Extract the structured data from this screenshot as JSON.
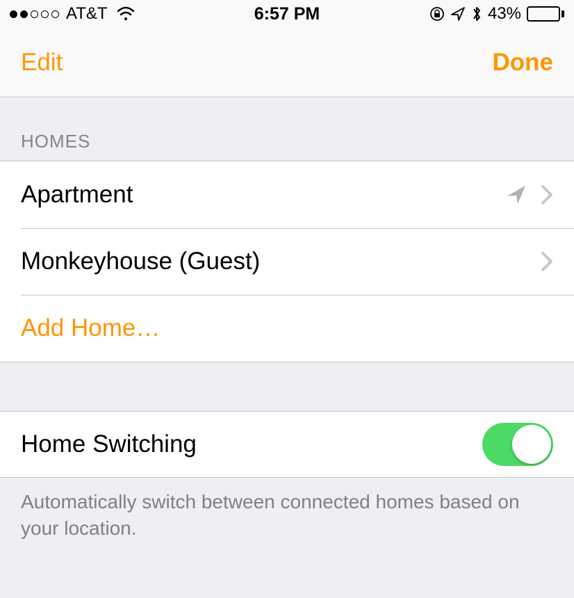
{
  "status_bar": {
    "carrier": "AT&T",
    "time": "6:57 PM",
    "battery_pct": "43%"
  },
  "nav": {
    "edit": "Edit",
    "done": "Done"
  },
  "section_header": "HOMES",
  "homes": [
    {
      "label": "Apartment",
      "has_location": true,
      "has_chevron": true
    },
    {
      "label": "Monkeyhouse (Guest)",
      "has_location": false,
      "has_chevron": true
    }
  ],
  "add_home_label": "Add Home…",
  "switching": {
    "label": "Home Switching",
    "footer": "Automatically switch between connected homes based on your location.",
    "on": true
  }
}
